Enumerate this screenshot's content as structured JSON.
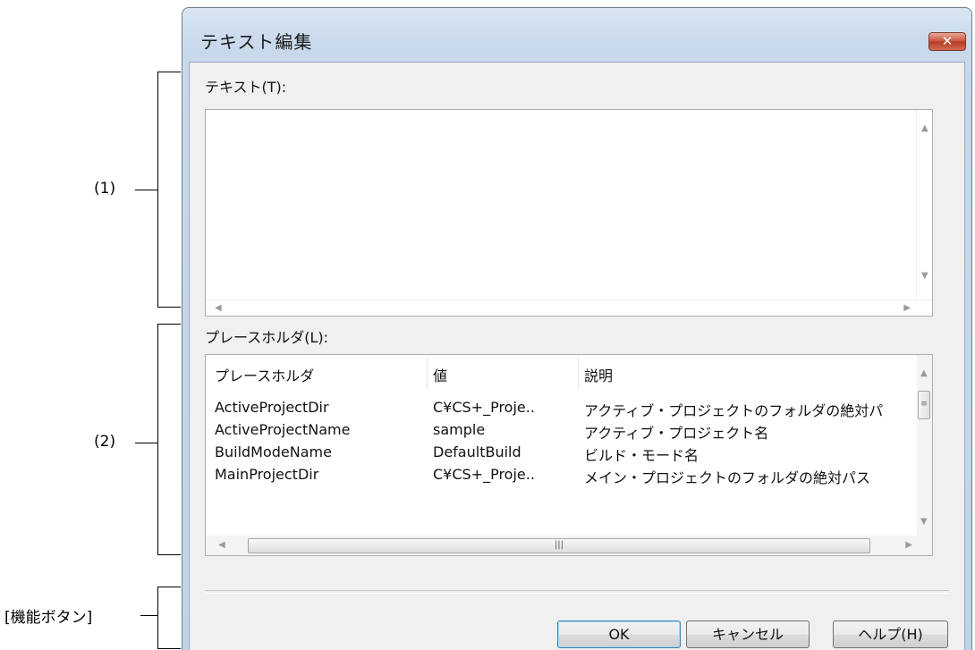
{
  "annotations": {
    "label1": "(1)",
    "label2": "(2)",
    "label3": "[機能ボタン]"
  },
  "dialog": {
    "title": "テキスト編集",
    "close_label": "✕",
    "text_label": "テキスト(T):",
    "text_value": "",
    "placeholder_label": "プレースホルダ(L):",
    "columns": [
      "プレースホルダ",
      "値",
      "説明"
    ],
    "rows": [
      {
        "name": "ActiveProjectDir",
        "value": "C¥CS+_Proje..",
        "desc": "アクティブ・プロジェクトのフォルダの絶対パ"
      },
      {
        "name": "ActiveProjectName",
        "value": "sample",
        "desc": "アクティブ・プロジェクト名"
      },
      {
        "name": "BuildModeName",
        "value": "DefaultBuild",
        "desc": "ビルド・モード名"
      },
      {
        "name": "MainProjectDir",
        "value": "C¥CS+_Proje..",
        "desc": "メイン・プロジェクトのフォルダの絶対パス"
      }
    ],
    "buttons": {
      "ok": "OK",
      "cancel": "キャンセル",
      "help": "ヘルプ(H)"
    }
  }
}
